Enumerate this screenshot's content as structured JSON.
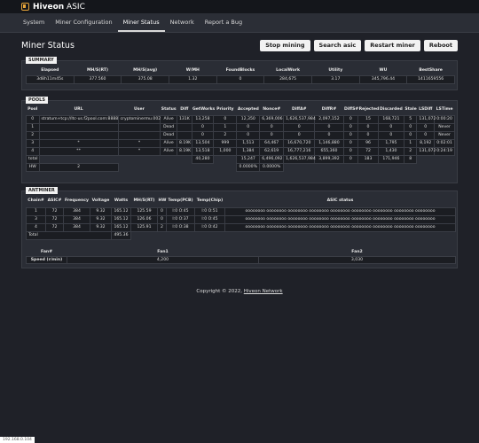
{
  "app": {
    "brand_bold": "Hiveon",
    "brand_rest": " ASIC"
  },
  "nav": [
    {
      "label": "System"
    },
    {
      "label": "Miner Configuration"
    },
    {
      "label": "Miner Status",
      "active": true
    },
    {
      "label": "Network"
    },
    {
      "label": "Report a Bug"
    }
  ],
  "page_title": "Miner Status",
  "buttons": {
    "stop": "Stop mining",
    "search": "Search asic",
    "restart": "Restart miner",
    "reboot": "Reboot"
  },
  "summary": {
    "title": "SUMMARY",
    "headers": [
      "Elapsed",
      "MH/S(RT)",
      "MH/S(avg)",
      "W/MH",
      "FoundBlocks",
      "LocalWork",
      "Utility",
      "WU",
      "BestShare"
    ],
    "values": [
      "3d8h11m45s",
      "377.560",
      "375.08",
      "1.32",
      "0",
      "284,675",
      "3.17",
      "345,796.44",
      "1411659556"
    ]
  },
  "pools": {
    "title": "POOLS",
    "headers": [
      "Pool",
      "URL",
      "User",
      "Status",
      "Diff",
      "GetWorks",
      "Priority",
      "Accepted",
      "Nonce#",
      "DiffA#",
      "DiffR#",
      "DiffS#",
      "Rejected",
      "Discarded",
      "Stale",
      "LSDiff",
      "LSTime"
    ],
    "rows": [
      [
        "0",
        "stratum+tcp://ltc-us.f2pool.com:8888",
        "cryptominermu.002",
        "Alive",
        "131K",
        "13,258",
        "0",
        "12,350",
        "6,369,006",
        "1,626,537,984",
        "2,097,152",
        "0",
        "15",
        "168,721",
        "5",
        "131,072",
        "0:00:20"
      ],
      [
        "1",
        "",
        "",
        "Dead",
        "",
        "0",
        "1",
        "0",
        "0",
        "0",
        "0",
        "0",
        "0",
        "0",
        "0",
        "0",
        "Never"
      ],
      [
        "2",
        "",
        "",
        "Dead",
        "",
        "0",
        "2",
        "0",
        "0",
        "0",
        "0",
        "0",
        "0",
        "0",
        "0",
        "0",
        "Never"
      ],
      [
        "3",
        "*",
        "*",
        "Alive",
        "8.19K",
        "13,504",
        "999",
        "1,513",
        "64,467",
        "16,670,720",
        "1,146,880",
        "0",
        "96",
        "1,795",
        "1",
        "8,192",
        "0:02:01"
      ],
      [
        "4",
        "**",
        "*",
        "Alive",
        "8.19K",
        "13,518",
        "1,000",
        "1,384",
        "62,619",
        "16,777,216",
        "655,360",
        "0",
        "72",
        "1,430",
        "2",
        "131,072",
        "0:24:19"
      ],
      [
        "total",
        "",
        "",
        "",
        "",
        "40,280",
        "",
        "15,247",
        "6,496,092",
        "1,626,537,984",
        "3,899,392",
        "0",
        "183",
        "171,946",
        "8",
        "",
        ""
      ],
      [
        "HW",
        "2",
        "",
        "",
        "",
        "",
        "",
        "0.0000%",
        "0.0000%",
        "",
        "",
        "",
        "",
        "",
        "",
        "",
        ""
      ]
    ]
  },
  "antminer": {
    "title": "ANTMINER",
    "headers": [
      "Chain#",
      "ASIC#",
      "Frequency",
      "Voltage",
      "Watts",
      "MH/S(RT)",
      "HW",
      "Temp(PCB)",
      "Temp(Chip)",
      "ASIC status"
    ],
    "rows": [
      [
        "1",
        "72",
        "384",
        "9.32",
        "165.12",
        "125.59",
        "0",
        "l:0 O:45",
        "l:0 O:51",
        "oooooooo oooooooo oooooooo oooooooo oooooooo oooooooo oooooooo oooooooo oooooooo"
      ],
      [
        "3",
        "72",
        "384",
        "9.32",
        "165.12",
        "126.06",
        "0",
        "l:0 O:37",
        "l:0 O:45",
        "oooooooo oooooooo oooooooo oooooooo oooooooo oooooooo oooooooo oooooooo oooooooo"
      ],
      [
        "4",
        "72",
        "384",
        "9.32",
        "165.12",
        "125.91",
        "2",
        "l:0 O:38",
        "l:0 O:42",
        "oooooooo oooooooo oooooooo oooooooo oooooooo oooooooo oooooooo oooooooo oooooooo"
      ]
    ],
    "total_label": "Total",
    "total_watts": "495.36",
    "fans": {
      "headers": [
        "Fan#",
        "Fan1",
        "Fan2"
      ],
      "label": "Speed (r/min)",
      "fan1": "4,200",
      "fan2": "3,030"
    }
  },
  "footer": {
    "text": "Copyright © 2022, ",
    "link": "Hiveon Network"
  },
  "status_url": "192.168.0.104"
}
